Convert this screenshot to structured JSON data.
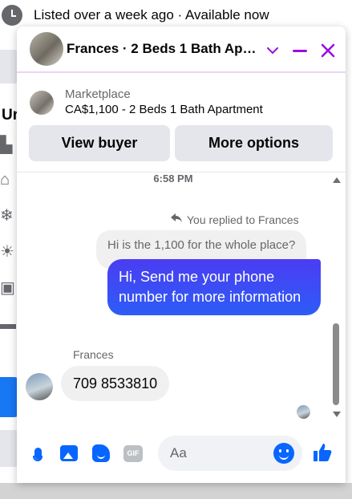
{
  "background": {
    "listing_status": "Listed over a week ago · Available now",
    "section_heading_fragment": "Ur"
  },
  "chat": {
    "header_title": "Frances · 2 Beds 1 Bath Ap…",
    "listing": {
      "label": "Marketplace",
      "title": "CA$1,100 - 2 Beds 1 Bath Apartment"
    },
    "actions": {
      "view_buyer": "View buyer",
      "more_options": "More options"
    },
    "messages": {
      "timestamp": "6:58 PM",
      "replied_note": "You replied to Frances",
      "quoted_message": "Hi is the 1,100 for the whole place?",
      "outgoing_message": "Hi, Send me your phone number for more information",
      "incoming_sender": "Frances",
      "incoming_message": "709 8533810"
    },
    "composer": {
      "placeholder": "Aa",
      "gif_label": "GIF"
    }
  },
  "colors": {
    "accent_purple": "#9b0ee0",
    "messenger_blue": "#0866ff",
    "bubble_gradient_top": "#4a3df2",
    "bubble_gradient_bottom": "#2e5cf7"
  }
}
